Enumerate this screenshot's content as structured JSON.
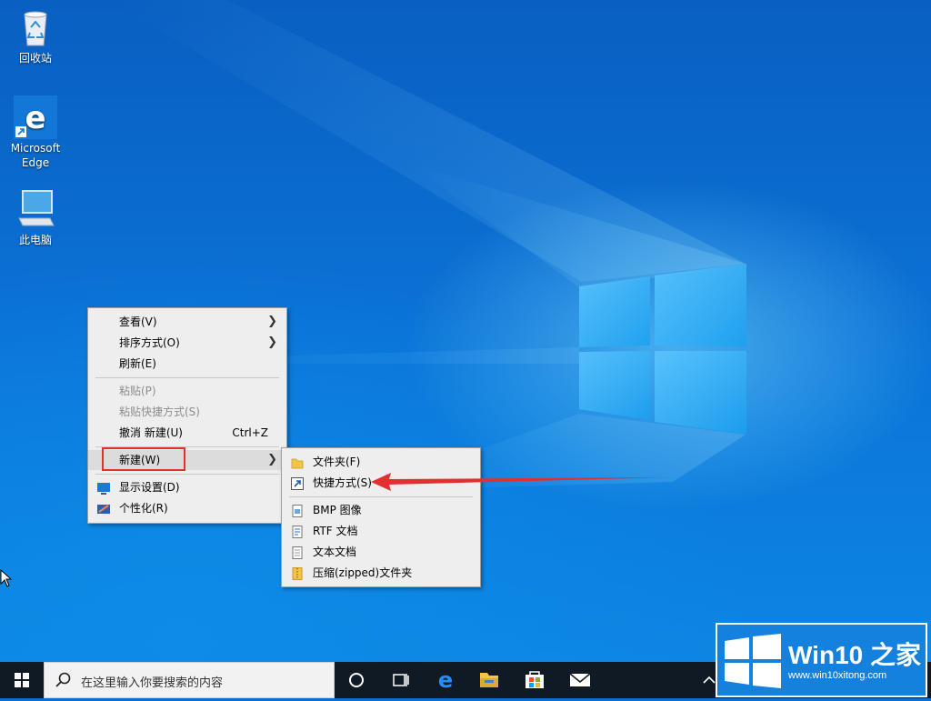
{
  "desktop_icons": [
    {
      "label": "回收站",
      "icon": "recycle-bin-icon"
    },
    {
      "label": "Microsoft Edge",
      "icon": "edge-icon"
    },
    {
      "label": "此电脑",
      "icon": "computer-icon"
    }
  ],
  "context_menu": {
    "items": [
      {
        "label": "查看(V)",
        "submenu": true
      },
      {
        "label": "排序方式(O)",
        "submenu": true
      },
      {
        "label": "刷新(E)"
      },
      {
        "label": "粘贴(P)",
        "disabled": true
      },
      {
        "label": "粘贴快捷方式(S)",
        "disabled": true
      },
      {
        "label": "撤消 新建(U)",
        "shortcut": "Ctrl+Z"
      },
      {
        "label": "新建(W)",
        "submenu": true,
        "highlighted": true
      },
      {
        "label": "显示设置(D)",
        "icon": "display-settings-icon"
      },
      {
        "label": "个性化(R)",
        "icon": "personalize-icon"
      }
    ]
  },
  "new_submenu": {
    "items": [
      {
        "label": "文件夹(F)",
        "icon": "folder-icon"
      },
      {
        "label": "快捷方式(S)",
        "icon": "shortcut-icon"
      },
      {
        "label": "BMP 图像",
        "icon": "bmp-file-icon"
      },
      {
        "label": "RTF 文档",
        "icon": "rtf-file-icon"
      },
      {
        "label": "文本文档",
        "icon": "text-file-icon"
      },
      {
        "label": "压缩(zipped)文件夹",
        "icon": "zip-folder-icon"
      }
    ]
  },
  "taskbar": {
    "search_placeholder": "在这里输入你要搜索的内容",
    "apps": [
      "cortana-icon",
      "task-view-icon",
      "edge-icon",
      "file-explorer-icon",
      "store-icon",
      "mail-icon"
    ]
  },
  "watermark": {
    "title": "Win10 之家",
    "url": "www.win10xitong.com"
  },
  "colors": {
    "highlight_box": "#e03030",
    "arrow": "#e03030",
    "taskbar": "#101a24"
  }
}
